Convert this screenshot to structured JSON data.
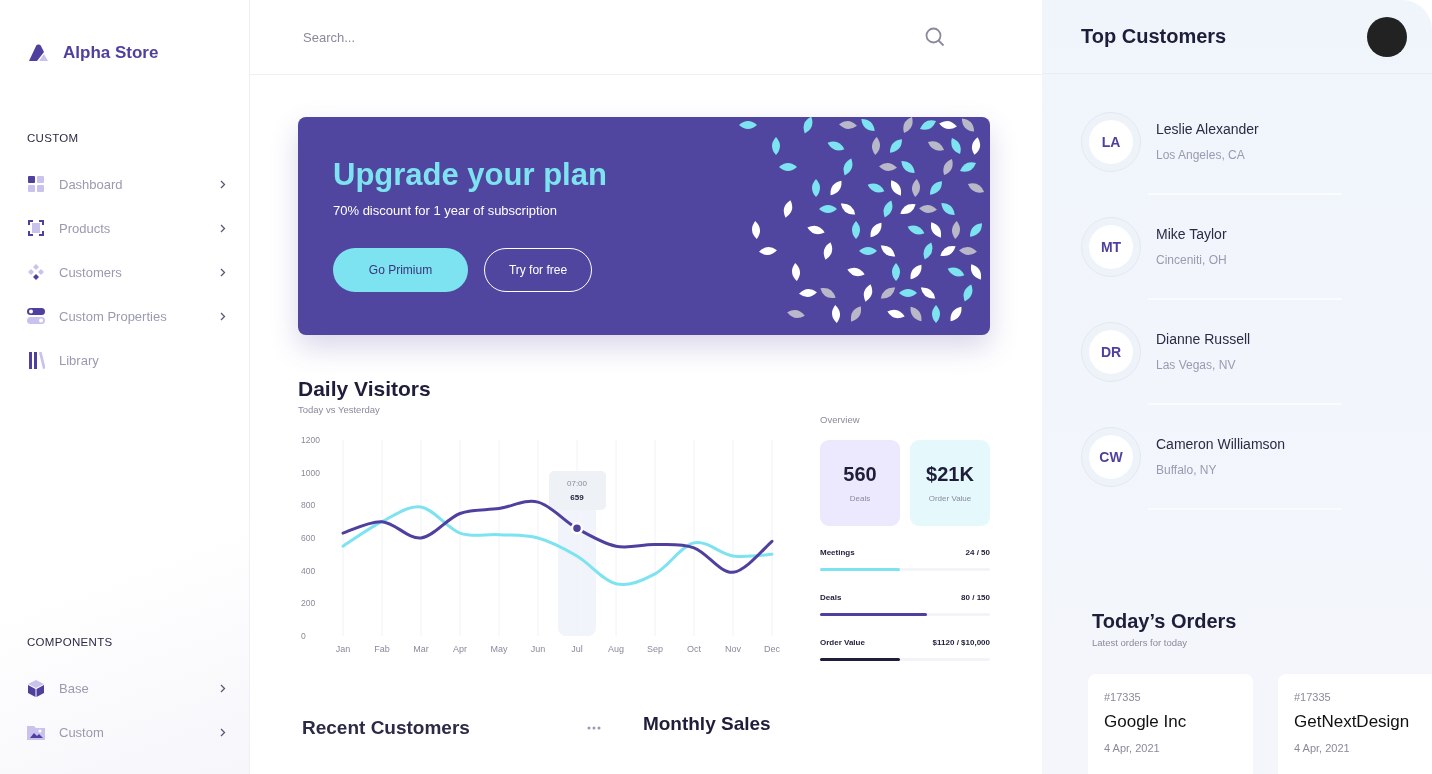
{
  "sidebar": {
    "brand": "Alpha Store",
    "sections": [
      {
        "title": "CUSTOM",
        "items": [
          {
            "label": "Dashboard",
            "has_submenu": true
          },
          {
            "label": "Products",
            "has_submenu": true
          },
          {
            "label": "Customers",
            "has_submenu": true
          },
          {
            "label": "Custom Properties",
            "has_submenu": true
          },
          {
            "label": "Library",
            "has_submenu": false
          }
        ]
      },
      {
        "title": "COMPONENTS",
        "items": [
          {
            "label": "Base",
            "has_submenu": true
          },
          {
            "label": "Custom",
            "has_submenu": true
          }
        ]
      }
    ]
  },
  "search": {
    "placeholder": "Search..."
  },
  "banner": {
    "title": "Upgrade your plan",
    "subtitle": "70% discount for 1 year of subscription",
    "buttons": [
      {
        "label": "Go Primium",
        "kind": "primary"
      },
      {
        "label": "Try for free",
        "kind": "outline"
      }
    ]
  },
  "daily_visitors": {
    "title": "Daily Visitors",
    "subtitle": "Today vs Yesterday",
    "tooltip": {
      "time": "07:00",
      "value": "659"
    },
    "chart_data": {
      "type": "line",
      "grid": true,
      "categories": [
        "Jan",
        "Fab",
        "Mar",
        "Apr",
        "May",
        "Jun",
        "Jul",
        "Aug",
        "Sep",
        "Oct",
        "Nov",
        "Dec"
      ],
      "ylim": [
        0,
        1200
      ],
      "yticks": [
        0,
        200,
        400,
        600,
        800,
        1000,
        1200
      ],
      "series": [
        {
          "color": "#7de3f0",
          "values": [
            550,
            700,
            790,
            630,
            620,
            600,
            490,
            320,
            380,
            570,
            490,
            500
          ]
        },
        {
          "color": "#4f3f9e",
          "values": [
            630,
            700,
            600,
            750,
            780,
            820,
            659,
            550,
            560,
            540,
            390,
            580
          ]
        }
      ]
    }
  },
  "overview": {
    "title": "Overview",
    "stats": [
      {
        "value": "560",
        "label": "Deals",
        "color": "#ece8fd"
      },
      {
        "value": "$21K",
        "label": "Order Value",
        "color": "#e5f9fc"
      }
    ],
    "progress": [
      {
        "label": "Meetings",
        "reading": "24 / 50",
        "level": 0.47,
        "color": "#7de3f0"
      },
      {
        "label": "Deals",
        "reading": "80 / 150",
        "level": 0.63,
        "color": "#4f3f9e"
      },
      {
        "label": "Order Value",
        "reading": "$1120 / $10,000",
        "level": 0.47,
        "color": "#1e1e3a"
      }
    ]
  },
  "recent_customers": {
    "title": "Recent Customers"
  },
  "monthly_sales": {
    "title": "Monthly Sales"
  },
  "top_customers": {
    "title": "Top Customers",
    "customers": [
      {
        "initials": "LA",
        "name": "Leslie Alexander",
        "location": "Los Angeles, CA"
      },
      {
        "initials": "MT",
        "name": "Mike Taylor",
        "location": "Cinceniti, OH"
      },
      {
        "initials": "DR",
        "name": "Dianne Russell",
        "location": "Las Vegas, NV"
      },
      {
        "initials": "CW",
        "name": "Cameron Williamson",
        "location": "Buffalo, NY"
      }
    ]
  },
  "todays_orders": {
    "title": "Today’s Orders",
    "subtitle": "Latest orders for today",
    "orders": [
      {
        "number": "#17335",
        "company": "Google Inc",
        "date": "4 Apr, 2021"
      },
      {
        "number": "#17335",
        "company": "GetNextDesign",
        "date": "4 Apr, 2021"
      }
    ]
  }
}
